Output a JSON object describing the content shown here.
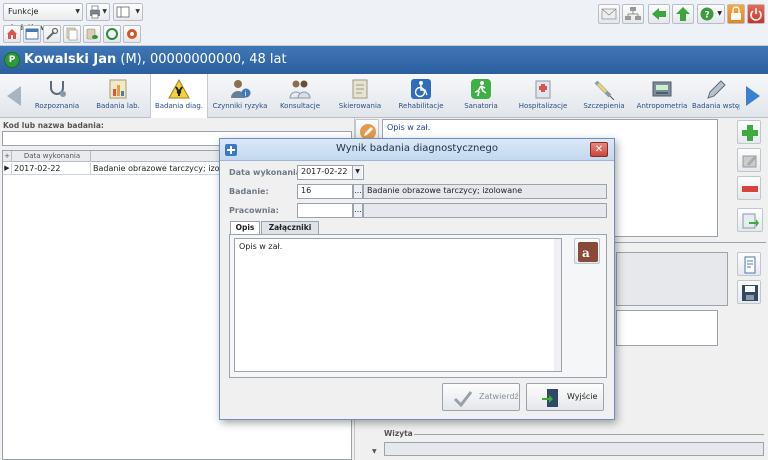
{
  "toolbar": {
    "funkcje_label": "Funkcje dodatkowe"
  },
  "patient": {
    "badge": "P",
    "name": "Kowalski Jan",
    "details": " (M), 00000000000, 48 lat"
  },
  "nav": {
    "items": [
      {
        "label": "Rozpoznania",
        "icon": "stethoscope-icon"
      },
      {
        "label": "Badania lab.",
        "icon": "lab-chart-icon"
      },
      {
        "label": "Badania diag.",
        "icon": "radiation-icon"
      },
      {
        "label": "Czynniki ryzyka",
        "icon": "person-info-icon"
      },
      {
        "label": "Konsultacje",
        "icon": "doctors-icon"
      },
      {
        "label": "Skierowania",
        "icon": "referral-icon"
      },
      {
        "label": "Rehabilitacje",
        "icon": "wheelchair-icon"
      },
      {
        "label": "Sanatoria",
        "icon": "running-man-icon"
      },
      {
        "label": "Hospitalizacje",
        "icon": "hospital-icon"
      },
      {
        "label": "Szczepienia",
        "icon": "syringe-icon"
      },
      {
        "label": "Antropometria",
        "icon": "scale-icon"
      },
      {
        "label": "Badania wstęp",
        "icon": "pen-icon"
      }
    ]
  },
  "left": {
    "search_label": "Kod lub nazwa badania:",
    "search_value": "",
    "grid": {
      "headers": [
        "Data wykonania",
        ""
      ],
      "rows": [
        {
          "date": "2017-02-22",
          "name": "Badanie obrazowe tarczycy; izolo"
        }
      ]
    }
  },
  "right": {
    "opis_text": "Opis w zał.",
    "wizyta_label": "Wizyta"
  },
  "dialog": {
    "title": "Wynik badania diagnostycznego",
    "data_label": "Data wykonania:",
    "data_value": "2017-02-22",
    "badanie_label": "Badanie:",
    "badanie_code": "16",
    "badanie_name": "Badanie obrazowe tarczycy; izolowane",
    "pracownia_label": "Pracownia:",
    "pracownia_value": "",
    "tabs": [
      "Opis",
      "Załączniki"
    ],
    "opis_text": "Opis w zał.",
    "ok_label": "Zatwierdź",
    "exit_label": "Wyjście",
    "close_glyph": "✕",
    "ellipsis": "..."
  },
  "colors": {
    "accent": "#2b5f9f",
    "nav_text": "#2c4f86"
  }
}
